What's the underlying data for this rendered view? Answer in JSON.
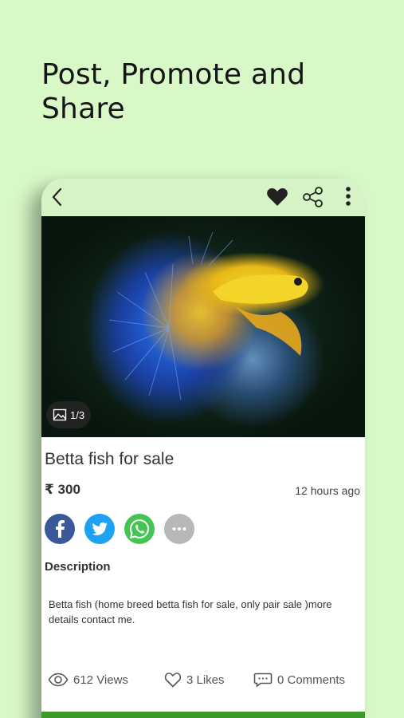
{
  "headline": {
    "line1": "Post, Promote and",
    "line2": "Share"
  },
  "appbar": {
    "icons": [
      "back-arrow-icon",
      "heart-icon",
      "share-icon",
      "more-vert-icon"
    ]
  },
  "listing": {
    "photo_counter": "1/3",
    "title": "Betta fish for sale",
    "price": "₹ 300",
    "posted": "12 hours ago",
    "description_heading": "Description",
    "description": "Betta fish (home breed betta fish for sale, only pair sale )more details contact me."
  },
  "share_buttons": [
    "facebook-icon",
    "twitter-icon",
    "whatsapp-icon",
    "more-options-icon"
  ],
  "stats": {
    "views": "612 Views",
    "likes": "3 Likes",
    "comments": "0 Comments"
  },
  "colors": {
    "background": "#d8f8c8",
    "appbar": "#d5f3c6",
    "accent_green": "#3c9a2a",
    "facebook": "#3b5998",
    "twitter": "#1da1f2",
    "whatsapp": "#43c553",
    "more": "#b7b7b7"
  }
}
